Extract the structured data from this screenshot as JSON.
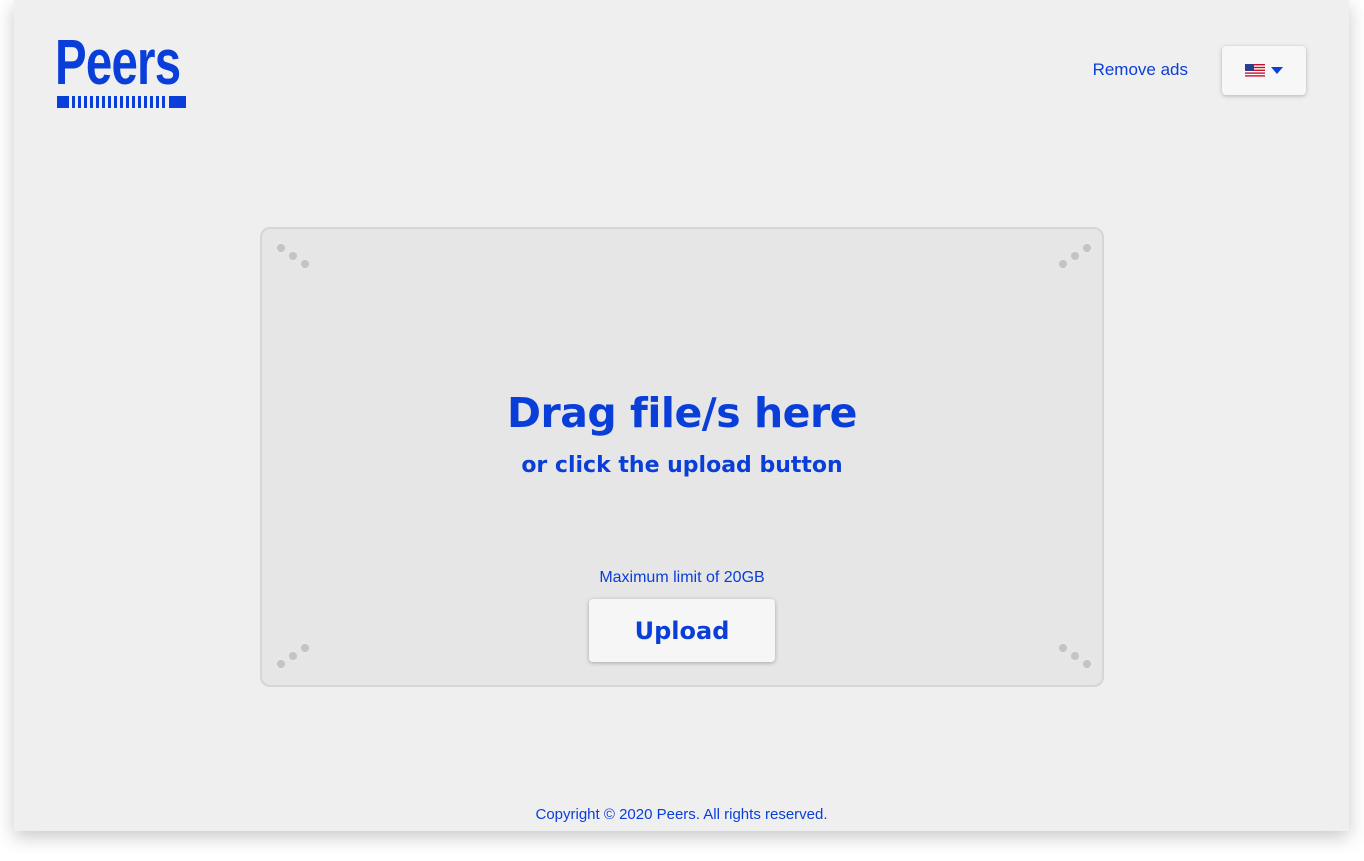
{
  "brand": {
    "logo_text": "Peers",
    "accent_color": "#0a3ed8"
  },
  "header": {
    "remove_ads_label": "Remove ads",
    "language_selector": {
      "selected_flag_icon": "us-flag-icon",
      "dropdown_icon": "caret-down-icon"
    }
  },
  "dropzone": {
    "title": "Drag file/s here",
    "subtitle": "or click the upload button",
    "limit_text": "Maximum limit of 20GB",
    "upload_label": "Upload"
  },
  "footer": {
    "copyright": "Copyright © 2020 Peers. All rights reserved."
  }
}
